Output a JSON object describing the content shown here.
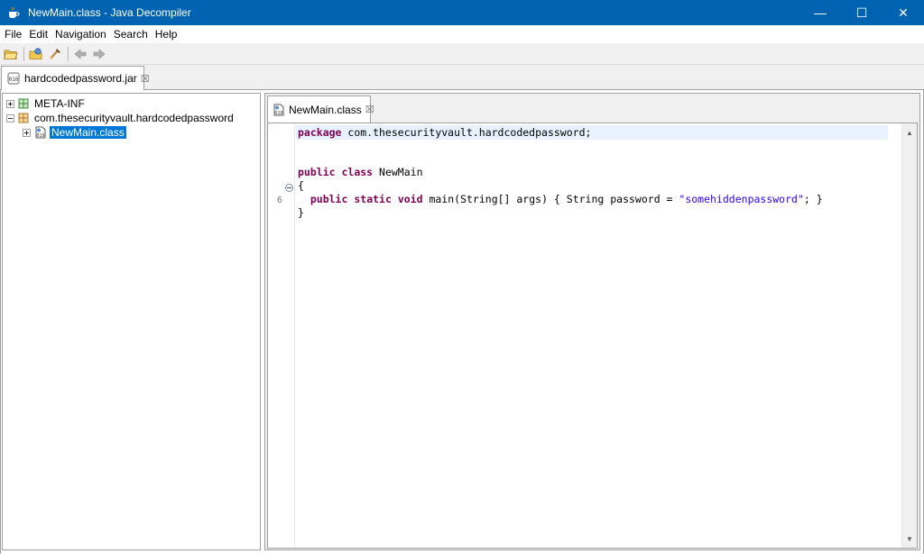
{
  "window": {
    "title": "NewMain.class - Java Decompiler",
    "controls": {
      "minimize": "—",
      "maximize": "☐",
      "close": "✕"
    }
  },
  "menu": [
    "File",
    "Edit",
    "Navigation",
    "Search",
    "Help"
  ],
  "toolbar": {
    "icons": [
      "open-file-icon",
      "open-type-icon",
      "open-type-hierarchy-icon",
      "back-icon",
      "forward-icon"
    ]
  },
  "outer_tab": {
    "label": "hardcodedpassword.jar",
    "close": "☒"
  },
  "tree": {
    "items": [
      {
        "label": "META-INF",
        "type": "package"
      },
      {
        "label": "com.thesecurityvault.hardcodedpassword",
        "type": "package"
      },
      {
        "label": "NewMain.class",
        "type": "class",
        "selected": true
      }
    ]
  },
  "editor_tab": {
    "label": "NewMain.class",
    "close": "☒"
  },
  "code": {
    "line1_kw": "package",
    "line1_rest": " com.thesecurityvault.hardcodedpassword;",
    "line4_kw1": "public",
    "line4_kw2": "class",
    "line4_rest": " NewMain",
    "line5": "{",
    "line6_kw1": "public",
    "line6_kw2": "static",
    "line6_kw3": "void",
    "line6_mid": " main(String[] args) { String password = ",
    "line6_str": "\"somehiddenpassword\"",
    "line6_end": "; }",
    "line7": "}",
    "line_number": "6"
  },
  "colors": {
    "titlebar": "#0063b1",
    "keyword": "#7f0055",
    "string": "#2a00ff",
    "selection": "#0078d7",
    "current_line": "#e8f2fe"
  }
}
